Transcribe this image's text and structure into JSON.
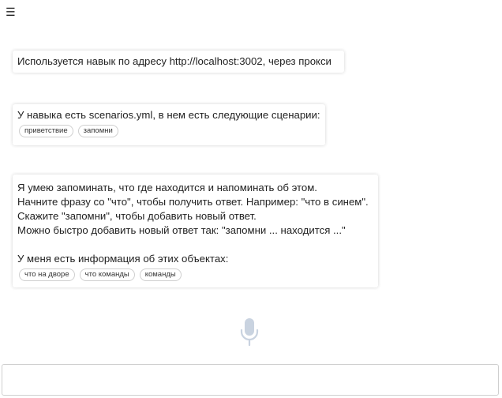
{
  "header": {
    "menu_icon": "☰"
  },
  "messages": [
    {
      "lines": [
        "Используется навык по адресу http://localhost:3002, через прокси"
      ],
      "chips": []
    },
    {
      "lines": [
        "У навыка есть scenarios.yml, в нем есть следующие сценарии:"
      ],
      "chips": [
        "приветствие",
        "запомни"
      ]
    },
    {
      "lines": [
        "Я умею запоминать, что где находится и напоминать об этом.",
        "Начните фразу со \"что\", чтобы получить ответ. Например: \"что в синем\".",
        "Скажите \"запомни\", чтобы добавить новый ответ.",
        "Можно быстро добавить новый ответ так: \"запомни ... находится ...\"",
        "",
        "У меня есть информация об этих объектах:"
      ],
      "chips": [
        "что на дворе",
        "что команды",
        "команды"
      ]
    }
  ],
  "mic": {
    "icon": "microphone-icon",
    "color": "#c9d3e0"
  },
  "input": {
    "value": "",
    "placeholder": ""
  }
}
